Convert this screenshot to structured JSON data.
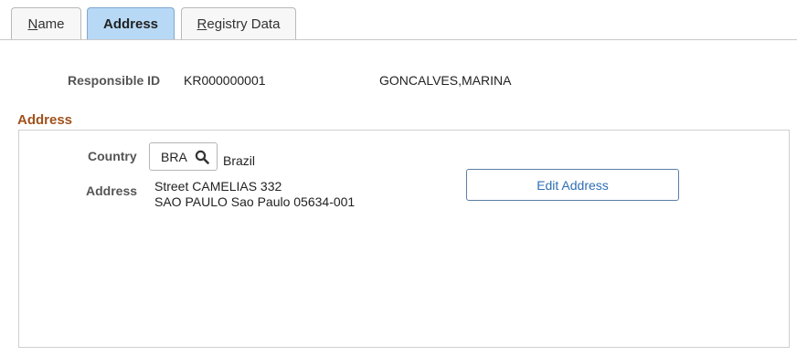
{
  "tabs": [
    {
      "label": "Name",
      "active": false
    },
    {
      "label": "Address",
      "active": true
    },
    {
      "label": "Registry Data",
      "active": false
    }
  ],
  "header": {
    "responsible_label": "Responsible ID",
    "responsible_id": "KR000000001",
    "responsible_name": "GONCALVES,MARINA"
  },
  "address_section": {
    "title": "Address",
    "country_label": "Country",
    "country_code": "BRA",
    "country_name": "Brazil",
    "address_label": "Address",
    "address_lines": [
      "Street CAMELIAS 332",
      "SAO PAULO Sao Paulo 05634-001"
    ],
    "edit_button_label": "Edit Address"
  },
  "colors": {
    "active_tab": "#b7d9f6",
    "section_title": "#a0521d",
    "button_text": "#2f6fb3"
  },
  "icons": {
    "country_lookup": "search-icon"
  }
}
